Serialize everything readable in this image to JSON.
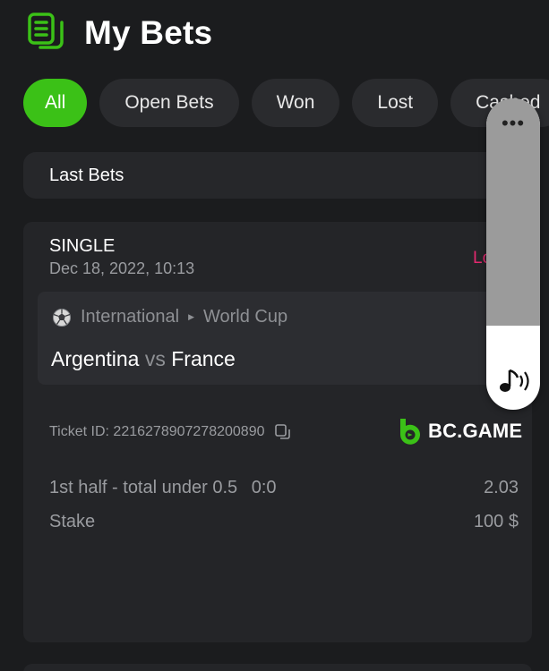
{
  "header": {
    "title": "My Bets",
    "icon": "bets-list-icon"
  },
  "tabs": [
    {
      "label": "All",
      "active": true
    },
    {
      "label": "Open Bets",
      "active": false
    },
    {
      "label": "Won",
      "active": false
    },
    {
      "label": "Lost",
      "active": false
    },
    {
      "label": "Cashed",
      "active": false
    }
  ],
  "section": {
    "title": "Last Bets"
  },
  "bet": {
    "type": "SINGLE",
    "date": "Dec 18, 2022, 10:13",
    "status": "Lost",
    "league": {
      "category": "International",
      "competition": "World Cup"
    },
    "match": {
      "home": "Argentina",
      "vs": "vs",
      "away": "France"
    },
    "ticket": {
      "label": "Ticket ID:",
      "id": "2216278907278200890"
    },
    "brand": "BC.GAME",
    "selection": {
      "market": "1st half - total under 0.5",
      "pick": "0:0",
      "odds": "2.03"
    },
    "stake": {
      "label": "Stake",
      "value": "100 $"
    }
  },
  "overlay": {
    "menu_icon": "more-dots-icon",
    "sound_icon": "sound-icon"
  },
  "colors": {
    "accent": "#3bc117",
    "lost": "#e3296f",
    "background": "#1b1c1e"
  }
}
